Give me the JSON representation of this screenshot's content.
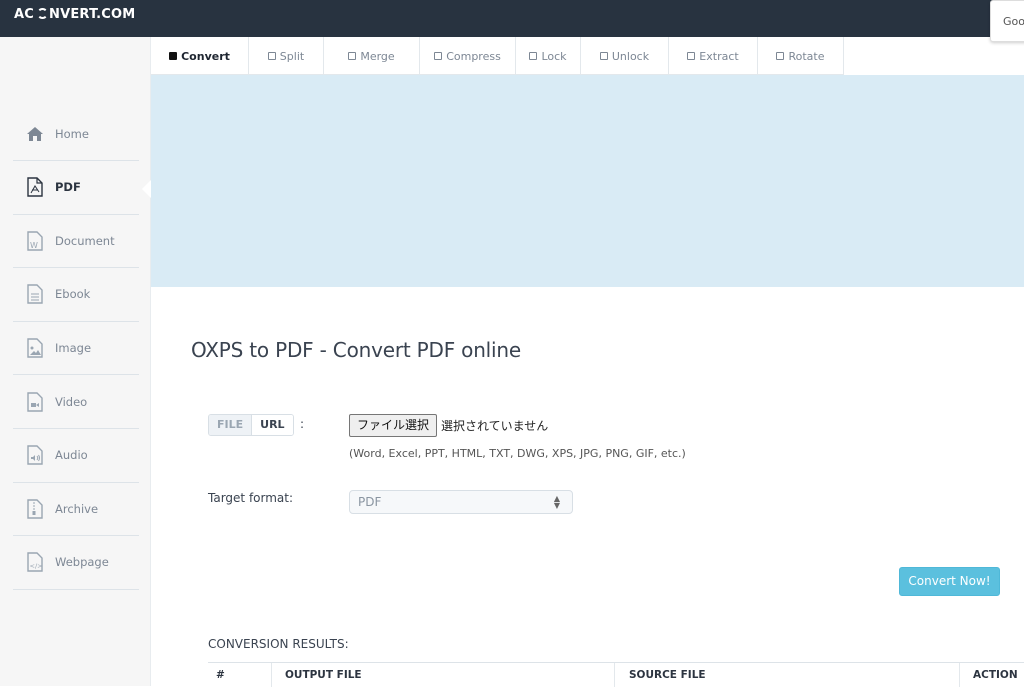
{
  "brand": {
    "logo_prefix": "AC",
    "logo_suffix": "NVERT.COM"
  },
  "popup": {
    "text": "Goo"
  },
  "sidebar": {
    "items": [
      {
        "label": "Home",
        "icon": "home-icon",
        "active": false
      },
      {
        "label": "PDF",
        "icon": "pdf-file-icon",
        "active": true
      },
      {
        "label": "Document",
        "icon": "word-document-icon",
        "active": false
      },
      {
        "label": "Ebook",
        "icon": "ebook-file-icon",
        "active": false
      },
      {
        "label": "Image",
        "icon": "image-file-icon",
        "active": false
      },
      {
        "label": "Video",
        "icon": "video-file-icon",
        "active": false
      },
      {
        "label": "Audio",
        "icon": "audio-file-icon",
        "active": false
      },
      {
        "label": "Archive",
        "icon": "archive-file-icon",
        "active": false
      },
      {
        "label": "Webpage",
        "icon": "webpage-file-icon",
        "active": false
      }
    ]
  },
  "tabs": [
    {
      "label": "Convert",
      "active": true
    },
    {
      "label": "Split",
      "active": false
    },
    {
      "label": "Merge",
      "active": false
    },
    {
      "label": "Compress",
      "active": false
    },
    {
      "label": "Lock",
      "active": false
    },
    {
      "label": "Unlock",
      "active": false
    },
    {
      "label": "Extract",
      "active": false
    },
    {
      "label": "Rotate",
      "active": false
    }
  ],
  "main": {
    "title": "OXPS to PDF - Convert PDF online",
    "source_toggle": {
      "file": "FILE",
      "url": "URL",
      "colon": ":"
    },
    "file_input": {
      "button_label": "ファイル選択",
      "status": "選択されていません"
    },
    "formats_hint": "(Word, Excel, PPT, HTML, TXT, DWG, XPS, JPG, PNG, GIF, etc.)",
    "target_format": {
      "label": "Target format:",
      "value": "PDF"
    },
    "convert_button": "Convert Now!",
    "results": {
      "label": "CONVERSION RESULTS:",
      "columns": [
        "#",
        "OUTPUT FILE",
        "SOURCE FILE",
        "ACTION"
      ]
    }
  },
  "colors": {
    "topbar": "#283340",
    "banner": "#d9ebf5",
    "accent": "#5bc0de"
  }
}
